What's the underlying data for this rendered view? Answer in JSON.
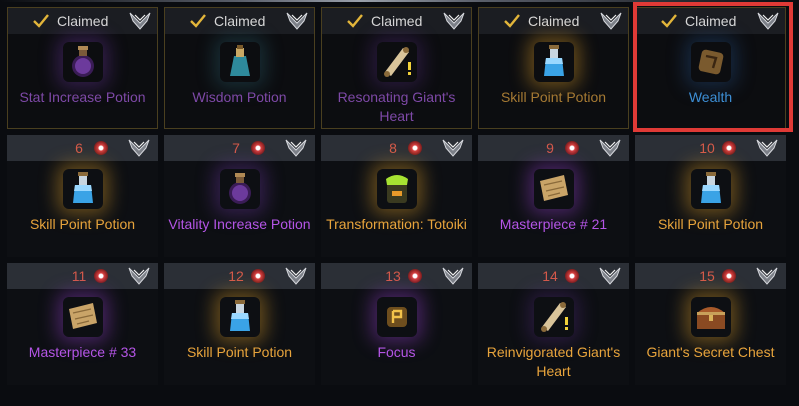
{
  "highlight_color": "#e03a36",
  "claimed_label": "Claimed",
  "rewards": [
    {
      "status": "claimed",
      "number": "",
      "name": "Stat Increase Potion",
      "icon": "purple-potion-icon",
      "color": "dim-purple"
    },
    {
      "status": "claimed",
      "number": "",
      "name": "Wisdom Potion",
      "icon": "teal-potion-icon",
      "color": "dim-purple"
    },
    {
      "status": "claimed",
      "number": "",
      "name": "Resonating Giant's Heart",
      "icon": "scroll-icon",
      "color": "dim-purple"
    },
    {
      "status": "claimed",
      "number": "",
      "name": "Skill Point Potion",
      "icon": "blue-potion-icon",
      "color": "dim-orange"
    },
    {
      "status": "claimed",
      "number": "",
      "name": "Wealth",
      "icon": "wealth-rune-icon",
      "color": "blue"
    },
    {
      "status": "locked",
      "number": "6",
      "name": "Skill Point Potion",
      "icon": "blue-potion-icon",
      "color": "orange"
    },
    {
      "status": "locked",
      "number": "7",
      "name": "Vitality Increase Potion",
      "icon": "purple-potion-icon",
      "color": "purple"
    },
    {
      "status": "locked",
      "number": "8",
      "name": "Transformation: Totoiki",
      "icon": "totoiki-icon",
      "color": "orange"
    },
    {
      "status": "locked",
      "number": "9",
      "name": "Masterpiece # 21",
      "icon": "map-icon",
      "color": "purple"
    },
    {
      "status": "locked",
      "number": "10",
      "name": "Skill Point Potion",
      "icon": "blue-potion-icon",
      "color": "orange"
    },
    {
      "status": "locked",
      "number": "11",
      "name": "Masterpiece # 33",
      "icon": "map-icon",
      "color": "purple"
    },
    {
      "status": "locked",
      "number": "12",
      "name": "Skill Point Potion",
      "icon": "blue-potion-icon",
      "color": "orange"
    },
    {
      "status": "locked",
      "number": "13",
      "name": "Focus",
      "icon": "focus-rune-icon",
      "color": "purple"
    },
    {
      "status": "locked",
      "number": "14",
      "name": "Reinvigorated Giant's Heart",
      "icon": "scroll-icon",
      "color": "orange"
    },
    {
      "status": "locked",
      "number": "15",
      "name": "Giant's Secret Chest",
      "icon": "chest-icon",
      "color": "orange"
    }
  ]
}
